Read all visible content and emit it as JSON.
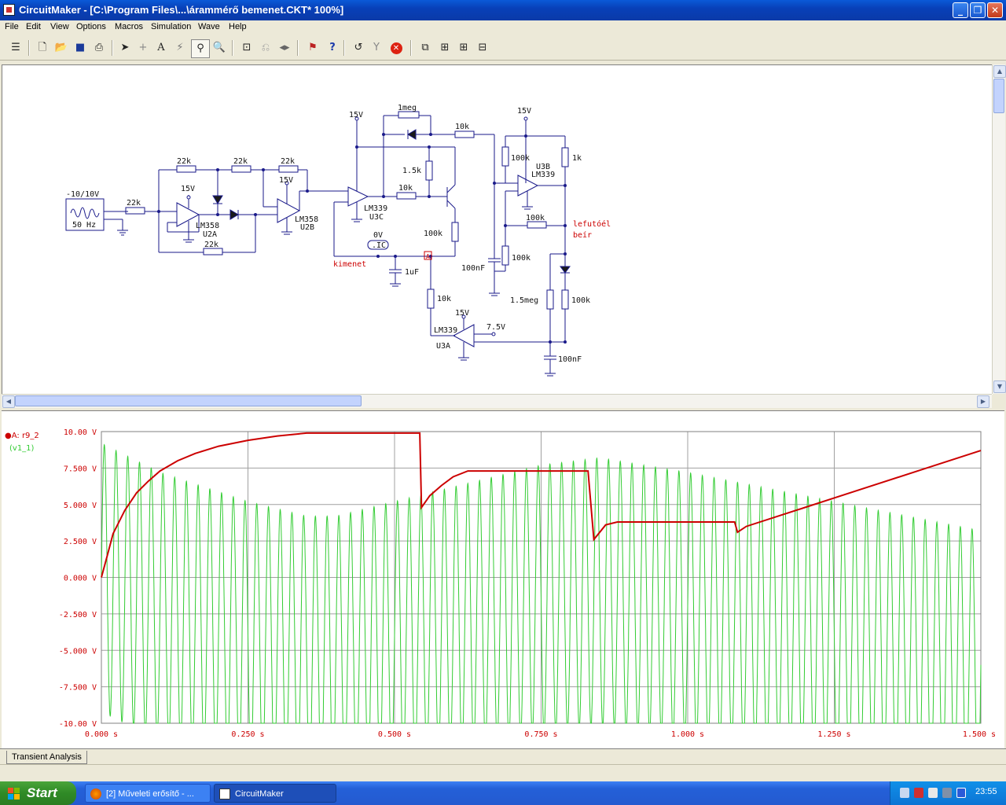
{
  "window": {
    "title": "CircuitMaker - [C:\\Program Files\\...\\árammérő bemenet.CKT* 100%]",
    "minimize_glyph": "_",
    "restore_glyph": "❐",
    "close_glyph": "✕"
  },
  "menu": [
    "File",
    "Edit",
    "View",
    "Options",
    "Macros",
    "Simulation",
    "Wave",
    "Help"
  ],
  "toolbar": {
    "icons": [
      "device-library-icon",
      "new-file-icon",
      "open-file-icon",
      "save-icon",
      "print-icon",
      "arrow-tool-icon",
      "wire-tool-icon",
      "text-tool-icon",
      "probe-tool-icon",
      "wand-tool-icon",
      "zoom-tool-icon",
      "zoom-fit-icon",
      "rotate-icon",
      "mirror-icon",
      "trace-icon",
      "help-icon",
      "reset-icon",
      "step-icon",
      "stop-icon",
      "view-1-icon",
      "view-2-icon",
      "view-3-icon",
      "view-4-icon"
    ]
  },
  "schematic": {
    "source_label": "-10/10V",
    "source_freq": "50 Hz",
    "labels": {
      "r_in": "22k",
      "r_fb1": "22k",
      "r_mid": "22k",
      "r_fb2": "22k",
      "r_bottom": "22k",
      "v_u2a": "15V",
      "v_u2b": "15V",
      "u2a_part": "LM358",
      "u2a_ref": "U2A",
      "u2b_part": "LM358",
      "u2b_ref": "U2B",
      "v_u3c": "15V",
      "r_1meg": "1meg",
      "r_15k": "1.5k",
      "r_10k_top": "10k",
      "r_10k_base": "10k",
      "u3c_part": "LM339",
      "u3c_ref": "U3C",
      "r_100k_emit": "100k",
      "ic_value": "0V",
      "ic_tag": ".IC",
      "probe": "A",
      "kimenet": "kimenet",
      "c_1uf": "1uF",
      "r_10k_low": "10k",
      "v_u3b": "15V",
      "r_100k_a": "100k",
      "u3b_ref": "U3B",
      "u3b_part": "LM339",
      "r_1k": "1k",
      "r_100k_fb": "100k",
      "lefutoel": "lefutóél",
      "beir": "beír",
      "c_100nf_a": "100nF",
      "r_100k_b": "100k",
      "r_15meg": "1.5meg",
      "r_100k_c": "100k",
      "u3a_part": "LM339",
      "u3a_ref": "U3A",
      "v_u3a": "15V",
      "v_ref": "7.5V",
      "c_100nf_b": "100nF"
    }
  },
  "graph": {
    "legend": {
      "a_label": "A: r9_2",
      "b_label": "(v1_1)"
    },
    "tab": "Transient Analysis"
  },
  "chart_data": {
    "type": "line",
    "xlabel": "",
    "ylabel": "",
    "xlim": [
      0,
      1.5
    ],
    "ylim": [
      -10,
      10
    ],
    "x_ticks": [
      "0.000 s",
      "0.250 s",
      "0.500 s",
      "0.750 s",
      "1.000 s",
      "1.250 s",
      "1.500 s"
    ],
    "y_ticks": [
      "10.00 V",
      "7.500 V",
      "5.000 V",
      "2.500 V",
      "0.000 V",
      "-2.500 V",
      "-5.000 V",
      "-7.500 V",
      "-10.00 V"
    ],
    "grid": true,
    "series": [
      {
        "name": "A: r9_2",
        "color": "#cc0000",
        "x": [
          0,
          0.01,
          0.02,
          0.04,
          0.06,
          0.08,
          0.1,
          0.13,
          0.16,
          0.2,
          0.25,
          0.3,
          0.35,
          0.4,
          0.45,
          0.5,
          0.543,
          0.546,
          0.56,
          0.58,
          0.6,
          0.625,
          0.7,
          0.8,
          0.83,
          0.84,
          0.86,
          0.88,
          0.9,
          1.0,
          1.08,
          1.085,
          1.1,
          1.2,
          1.3,
          1.4,
          1.5
        ],
        "y": [
          0,
          1.5,
          3.0,
          4.6,
          5.8,
          6.6,
          7.3,
          8.0,
          8.5,
          9.0,
          9.4,
          9.7,
          9.9,
          9.9,
          9.9,
          9.9,
          9.9,
          4.8,
          5.6,
          6.3,
          6.9,
          7.3,
          7.3,
          7.3,
          7.3,
          2.6,
          3.6,
          3.8,
          3.8,
          3.8,
          3.8,
          3.1,
          3.5,
          4.8,
          6.1,
          7.4,
          8.7
        ]
      },
      {
        "name": "v1_1",
        "color": "#33cc33",
        "frequency_hz": 50,
        "carrier_amplitude_v": 10,
        "offset_envelope": {
          "x": [
            0,
            0.1,
            0.25,
            0.35,
            0.4,
            0.5,
            0.6,
            0.75,
            0.85,
            1.0,
            1.25,
            1.5
          ],
          "y": [
            0,
            -2,
            -4,
            -5,
            -5,
            -4,
            -3,
            -1.5,
            -1,
            -2,
            -4,
            -6
          ]
        }
      }
    ]
  },
  "taskbar": {
    "start": "Start",
    "tasks": [
      {
        "label": "[2] Műveleti erősítő - ...",
        "active": false
      },
      {
        "label": "CircuitMaker",
        "active": true
      }
    ],
    "clock": "23:55"
  }
}
